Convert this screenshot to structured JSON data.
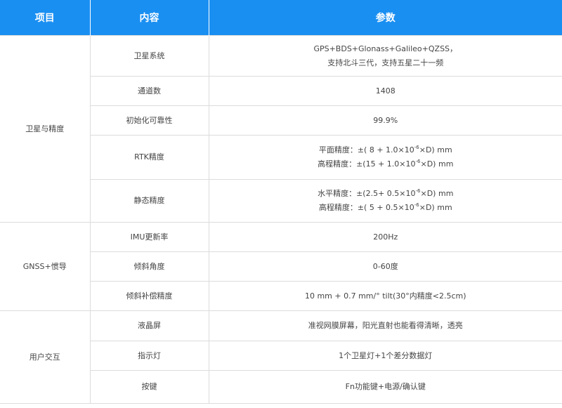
{
  "header": {
    "col_item": "项目",
    "col_content": "内容",
    "col_param": "参数"
  },
  "groups": [
    {
      "name": "卫星与精度",
      "rows": [
        {
          "content": "卫星系统",
          "lines": [
            "GPS+BDS+Glonass+Galileo+QZSS，",
            "支持北斗三代，支持五星二十一频"
          ]
        },
        {
          "content": "通道数",
          "lines": [
            "1408"
          ]
        },
        {
          "content": "初始化可靠性",
          "lines": [
            "99.9%"
          ]
        },
        {
          "content": "RTK精度",
          "lines": [
            {
              "pre": "平面精度：±(  8 + 1.0×10",
              "sup": "-6",
              "post": "×D) mm"
            },
            {
              "pre": "高程精度：±(15 + 1.0×10",
              "sup": "-6",
              "post": "×D) mm"
            }
          ]
        },
        {
          "content": "静态精度",
          "lines": [
            {
              "pre": "水平精度：±(2.5+ 0.5×10",
              "sup": "-6",
              "post": "×D) mm"
            },
            {
              "pre": "高程精度：±( 5 + 0.5×10",
              "sup": "-6",
              "post": "×D) mm"
            }
          ]
        }
      ]
    },
    {
      "name": "GNSS+惯导",
      "rows": [
        {
          "content": "IMU更新率",
          "lines": [
            "200Hz"
          ]
        },
        {
          "content": "倾斜角度",
          "lines": [
            "0-60度"
          ]
        },
        {
          "content": "倾斜补偿精度",
          "lines": [
            "10 mm + 0.7 mm/° tilt(30°内精度<2.5cm)"
          ]
        }
      ]
    },
    {
      "name": "用户交互",
      "rows": [
        {
          "content": "液晶屏",
          "lines": [
            "准视网膜屏幕，阳光直射也能看得清晰，透亮"
          ]
        },
        {
          "content": "指示灯",
          "lines": [
            "1个卫星灯+1个差分数据灯"
          ]
        },
        {
          "content": "按键",
          "lines": [
            "Fn功能键+电源/确认键"
          ]
        }
      ]
    }
  ]
}
